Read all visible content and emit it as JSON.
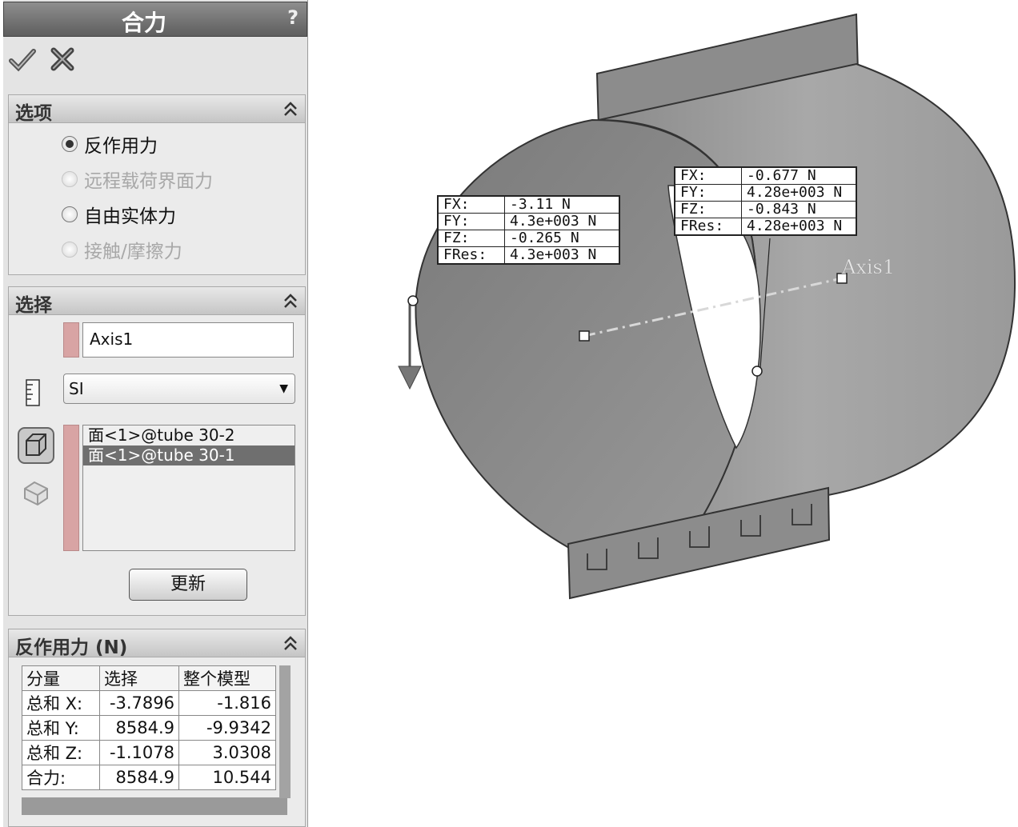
{
  "panel": {
    "title": "合力",
    "help": "?",
    "options": {
      "title": "选项",
      "items": [
        {
          "label": "反作用力",
          "selected": true,
          "enabled": true
        },
        {
          "label": "远程载荷界面力",
          "selected": false,
          "enabled": false
        },
        {
          "label": "自由实体力",
          "selected": false,
          "enabled": true
        },
        {
          "label": "接触/摩擦力",
          "selected": false,
          "enabled": false
        }
      ]
    },
    "selection": {
      "title": "选择",
      "axis_value": "Axis1",
      "units_value": "SI",
      "faces": [
        "面<1>@tube 30-2",
        "面<1>@tube 30-1"
      ],
      "update_label": "更新"
    },
    "results": {
      "title": "反作用力 (N)",
      "headers": [
        "分量",
        "选择",
        "整个模型"
      ],
      "rows": [
        [
          "总和 X:",
          "-3.7896",
          "-1.816"
        ],
        [
          "总和 Y:",
          "8584.9",
          "-9.9342"
        ],
        [
          "总和 Z:",
          "-1.1078",
          "3.0308"
        ],
        [
          "合力:",
          "8584.9",
          "10.544"
        ]
      ]
    }
  },
  "viewport": {
    "axis_label": "Axis1",
    "callout_left": [
      [
        "FX:",
        "-3.11 N"
      ],
      [
        "FY:",
        "4.3e+003 N"
      ],
      [
        "FZ:",
        "-0.265 N"
      ],
      [
        "FRes:",
        "4.3e+003 N"
      ]
    ],
    "callout_right": [
      [
        "FX:",
        "-0.677 N"
      ],
      [
        "FY:",
        "4.28e+003 N"
      ],
      [
        "FZ:",
        "-0.843 N"
      ],
      [
        "FRes:",
        "4.28e+003 N"
      ]
    ]
  }
}
